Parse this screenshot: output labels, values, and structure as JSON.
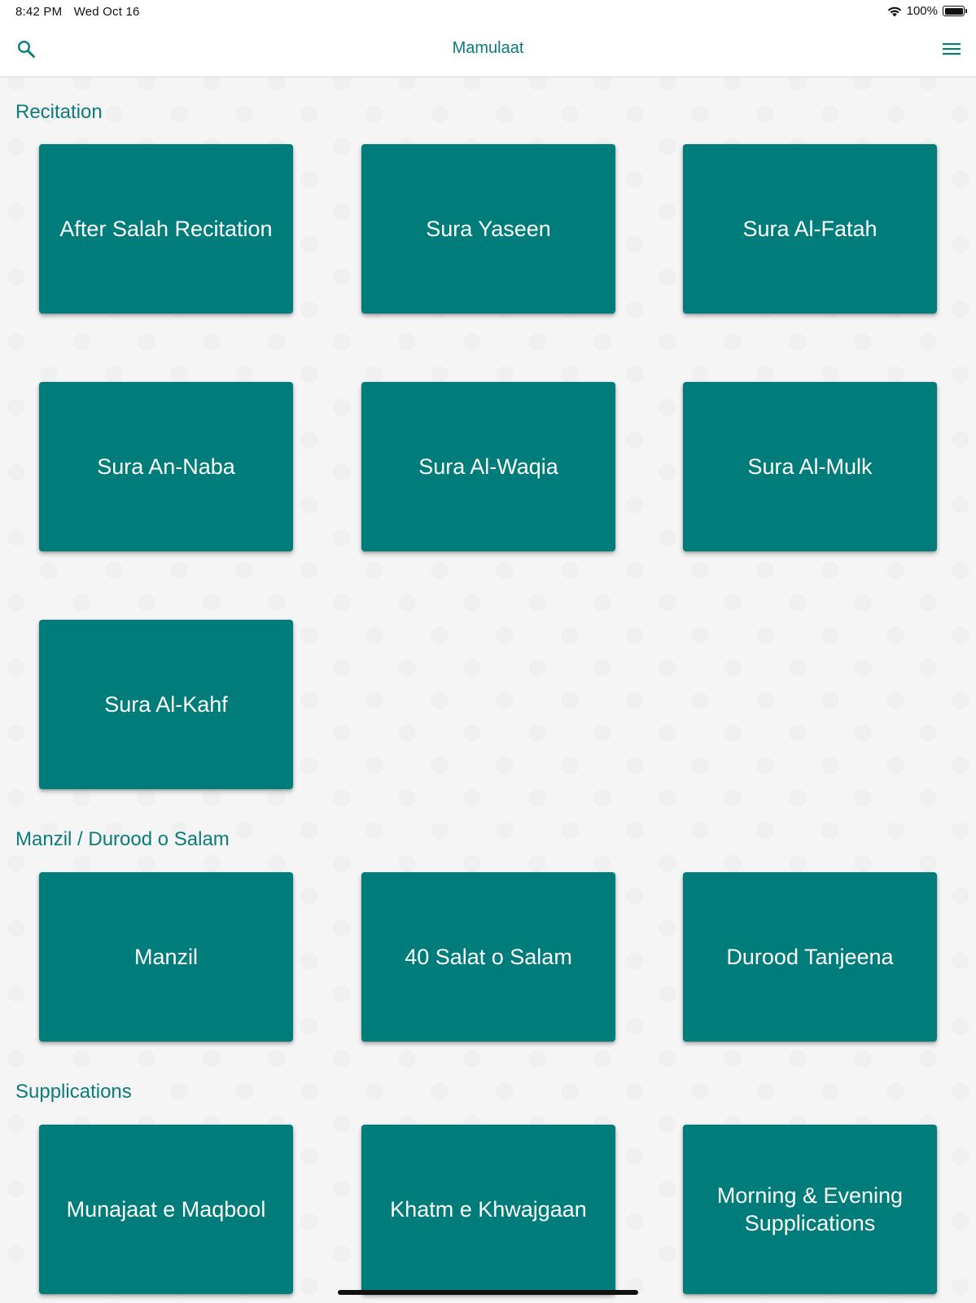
{
  "status_bar": {
    "time": "8:42 PM",
    "date": "Wed Oct 16",
    "battery": "100%",
    "icons": [
      "wifi-icon",
      "battery-icon"
    ]
  },
  "nav": {
    "title": "Mamulaat",
    "left_icon": "search-icon",
    "right_icon": "menu-icon"
  },
  "sections": [
    {
      "title": "Recitation",
      "items": [
        "After Salah Recitation",
        "Sura Yaseen",
        "Sura Al-Fatah",
        "Sura An-Naba",
        "Sura Al-Waqia",
        "Sura Al-Mulk",
        "Sura Al-Kahf"
      ]
    },
    {
      "title": "Manzil / Durood o Salam",
      "items": [
        "Manzil",
        "40 Salat o Salam",
        "Durood Tanjeena"
      ]
    },
    {
      "title": "Supplications",
      "items": [
        "Munajaat e Maqbool",
        "Khatm e Khwajgaan",
        "Morning & Evening Supplications"
      ]
    }
  ],
  "colors": {
    "accent": "#0b7b7b",
    "tile": "#007d7b",
    "tile_text": "#ffffff",
    "background": "#f5f5f5"
  }
}
